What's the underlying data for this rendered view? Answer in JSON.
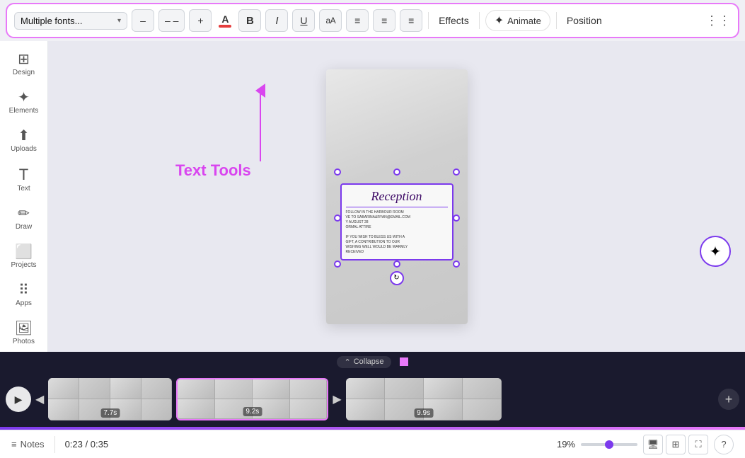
{
  "toolbar": {
    "font_selector": "Multiple fonts...",
    "decrease_label": "–",
    "dash_label": "– –",
    "increase_label": "+",
    "color_letter": "A",
    "bold_label": "B",
    "italic_label": "I",
    "underline_label": "U",
    "aa_label": "aA",
    "align1": "≡",
    "align2": "≡",
    "align3": "≡",
    "effects_label": "Effects",
    "animate_label": "Animate",
    "position_label": "Position",
    "dots_label": "⋮⋮"
  },
  "sidebar": {
    "items": [
      {
        "id": "design",
        "icon": "⊞",
        "label": "Design"
      },
      {
        "id": "elements",
        "icon": "✦",
        "label": "Elements"
      },
      {
        "id": "uploads",
        "icon": "↑",
        "label": "Uploads"
      },
      {
        "id": "text",
        "icon": "T",
        "label": "Text"
      },
      {
        "id": "draw",
        "icon": "✏",
        "label": "Draw"
      },
      {
        "id": "projects",
        "icon": "□",
        "label": "Projects"
      },
      {
        "id": "apps",
        "icon": "⋯",
        "label": "Apps"
      },
      {
        "id": "photos",
        "icon": "🖼",
        "label": "Photos"
      }
    ]
  },
  "annotation": {
    "text": "Text Tools",
    "arrow": "↑"
  },
  "card": {
    "reception": "Reception",
    "lines": [
      "FOLLOW IN THE HARBOUR ROOM",
      "VE TO SABARINA&RYAN@EMAIL.COM",
      "Y AUGUST 28",
      "ORMAL ATTIRE",
      "IF YOU WISH TO BLESS US WITH A",
      "GIFT, A CONTRIBUTION TO OUR",
      "WISHING WELL WOULD BE WARMLY",
      "RECEIVED"
    ]
  },
  "timeline": {
    "play_icon": "▶",
    "segments": [
      {
        "duration": "7.7s",
        "active": false
      },
      {
        "duration": "9.2s",
        "active": true
      },
      {
        "duration": "9.9s",
        "active": false
      }
    ],
    "collapse_label": "⌃",
    "add_icon": "+",
    "prev_icon": "◀",
    "next_icon": "▶"
  },
  "status": {
    "notes_icon": "≡",
    "notes_label": "Notes",
    "time_current": "0:23",
    "time_total": "0:35",
    "time_sep": "/",
    "zoom_level": "19%",
    "fullscreen_icon": "⛶",
    "layout_icon": "⊞",
    "expand_icon": "⛶",
    "help_icon": "?"
  }
}
